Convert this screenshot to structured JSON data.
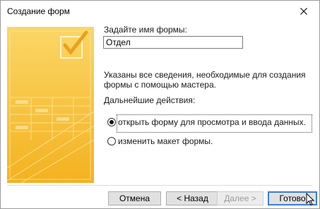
{
  "window": {
    "title": "Создание форм"
  },
  "form_name": {
    "label": "Задайте имя формы:",
    "value": "Отдел"
  },
  "info_text": "Указаны все сведения, необходимые для создания формы с помощью мастера.",
  "next_actions": {
    "label": "Дальнейшие действия:",
    "options": [
      {
        "text": "открыть форму для просмотра и ввода данных.",
        "checked": true
      },
      {
        "text": "изменить макет формы.",
        "checked": false
      }
    ]
  },
  "buttons": {
    "cancel": "Отмена",
    "back": "< Назад",
    "next": "Далее >",
    "finish": "Готово"
  },
  "colors": {
    "accent": "#3c7fd1",
    "wizard_yellow": "#f7c63a"
  }
}
